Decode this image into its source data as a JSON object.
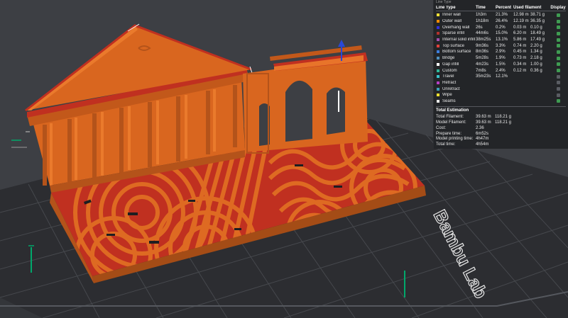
{
  "panel": {
    "header_strip": "Line Type",
    "columns": {
      "line_type": "Line Type",
      "time": "Time",
      "percent": "Percent",
      "used": "Used filament",
      "display": "Display"
    },
    "rows": [
      {
        "label": "Inner wall",
        "time": "1h3m",
        "pct": "21.3%",
        "m": "12.98 m",
        "g": "38.71 g",
        "color": "#ffe135",
        "display": true
      },
      {
        "label": "Outer wall",
        "time": "1h18m",
        "pct": "26.4%",
        "m": "12.19 m",
        "g": "36.35 g",
        "color": "#ff8c00",
        "display": true
      },
      {
        "label": "Overhang wall",
        "time": "26s",
        "pct": "0.2%",
        "m": "0.03 m",
        "g": "0.10 g",
        "color": "#2f2fd8",
        "display": true
      },
      {
        "label": "Sparse infill",
        "time": "44m6s",
        "pct": "15.0%",
        "m": "6.20 m",
        "g": "18.49 g",
        "color": "#b2312e",
        "display": true
      },
      {
        "label": "Internal solid infill",
        "time": "38m25s",
        "pct": "13.1%",
        "m": "5.86 m",
        "g": "17.49 g",
        "color": "#a04fae",
        "display": true
      },
      {
        "label": "Top surface",
        "time": "9m36s",
        "pct": "3.3%",
        "m": "0.74 m",
        "g": "2.20 g",
        "color": "#e0413b",
        "display": true
      },
      {
        "label": "Bottom surface",
        "time": "8m36s",
        "pct": "2.9%",
        "m": "0.45 m",
        "g": "1.34 g",
        "color": "#3d7ede",
        "display": true
      },
      {
        "label": "Bridge",
        "time": "5m28s",
        "pct": "1.9%",
        "m": "0.73 m",
        "g": "2.18 g",
        "color": "#4f8fbd",
        "display": true
      },
      {
        "label": "Gap infill",
        "time": "4m23s",
        "pct": "1.5%",
        "m": "0.34 m",
        "g": "1.00 g",
        "color": "#ffffff",
        "display": true
      },
      {
        "label": "Custom",
        "time": "7m8s",
        "pct": "2.4%",
        "m": "0.12 m",
        "g": "0.36 g",
        "color": "#2fb89a",
        "display": true
      },
      {
        "label": "Travel",
        "time": "35m23s",
        "pct": "12.1%",
        "m": "",
        "g": "",
        "color": "#39c4cc",
        "display": false
      },
      {
        "label": "Retract",
        "time": "",
        "pct": "",
        "m": "",
        "g": "",
        "color": "#b640c4",
        "display": false
      },
      {
        "label": "Unretract",
        "time": "",
        "pct": "",
        "m": "",
        "g": "",
        "color": "#3ba0b8",
        "display": false
      },
      {
        "label": "Wipe",
        "time": "",
        "pct": "",
        "m": "",
        "g": "",
        "color": "#f0e030",
        "display": false
      },
      {
        "label": "Seams",
        "time": "",
        "pct": "",
        "m": "",
        "g": "",
        "color": "#e8e8e8",
        "display": true
      }
    ],
    "estimation_title": "Total Estimation",
    "estimation": [
      {
        "label": "Total Filament:",
        "v1": "39.63 m",
        "v2": "118.21 g"
      },
      {
        "label": "Model Filament:",
        "v1": "39.63 m",
        "v2": "118.21 g"
      },
      {
        "label": "Cost:",
        "v1": "2.36",
        "v2": ""
      },
      {
        "label": "Prepare time:",
        "v1": "6m52s",
        "v2": ""
      },
      {
        "label": "Model printing time:",
        "v1": "4h47m",
        "v2": ""
      },
      {
        "label": "Total time:",
        "v1": "4h54m",
        "v2": ""
      }
    ]
  },
  "bed": {
    "label": "Bambu Lab"
  },
  "colors": {
    "background": "#3d3f44",
    "bed": "#2e2f33",
    "grid": "#45474c",
    "model": "#d9661f",
    "model_shadow": "#a44c16",
    "infill": "#c1301f",
    "axis": "#2848d8",
    "accent": "#00a86b"
  }
}
